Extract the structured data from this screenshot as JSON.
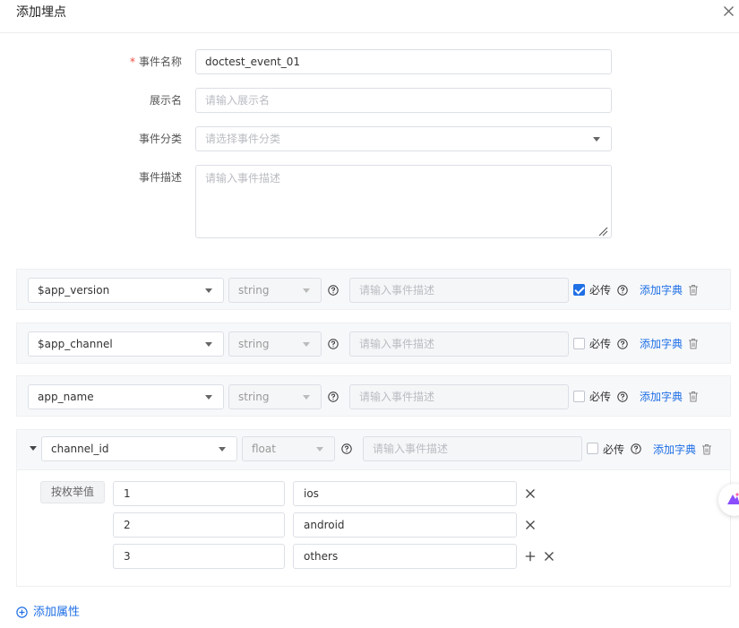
{
  "dialog": {
    "title": "添加埋点"
  },
  "form": {
    "event_name": {
      "label": "事件名称",
      "required_mark": "*",
      "value": "doctest_event_01"
    },
    "display_name": {
      "label": "展示名",
      "placeholder": "请输入展示名"
    },
    "category": {
      "label": "事件分类",
      "placeholder": "请选择事件分类"
    },
    "description": {
      "label": "事件描述",
      "placeholder": "请输入事件描述"
    }
  },
  "properties": [
    {
      "name": "$app_version",
      "type": "string",
      "desc_placeholder": "请输入事件描述",
      "required_checked": true,
      "required_label": "必传",
      "dict_label": "添加字典"
    },
    {
      "name": "$app_channel",
      "type": "string",
      "desc_placeholder": "请输入事件描述",
      "required_checked": false,
      "required_label": "必传",
      "dict_label": "添加字典"
    },
    {
      "name": "app_name",
      "type": "string",
      "desc_placeholder": "请输入事件描述",
      "required_checked": false,
      "required_label": "必传",
      "dict_label": "添加字典"
    },
    {
      "name": "channel_id",
      "type": "float",
      "desc_placeholder": "请输入事件描述",
      "required_checked": false,
      "required_label": "必传",
      "dict_label": "添加字典",
      "enum_label": "按枚举值",
      "enums": [
        {
          "key": "1",
          "value": "ios"
        },
        {
          "key": "2",
          "value": "android"
        },
        {
          "key": "3",
          "value": "others"
        }
      ]
    }
  ],
  "add_attribute": {
    "label": "添加属性"
  },
  "colors": {
    "accent": "#1f6fe5",
    "required": "#f0483e",
    "panel_bg": "#f7f8fa"
  },
  "icons": [
    "close-icon",
    "chevron-down-icon",
    "help-icon",
    "trash-icon",
    "plus-icon",
    "x-icon",
    "add-circle-icon"
  ]
}
